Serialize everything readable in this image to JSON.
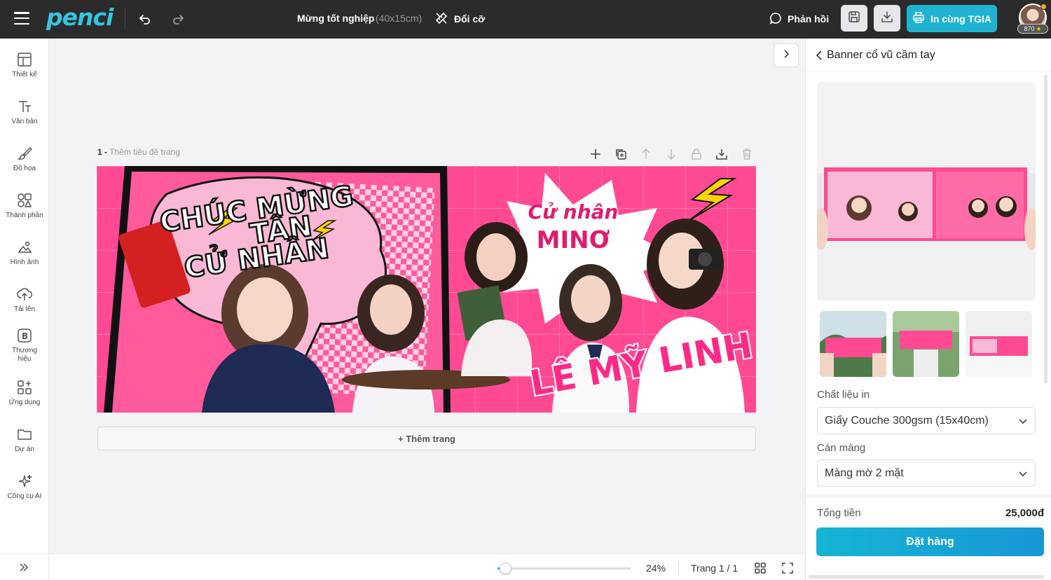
{
  "app": {
    "logo": "penci"
  },
  "topbar": {
    "doc_title": "Mừng tốt nghiệp",
    "doc_size": "(40x15cm)",
    "resize_label": "Đổi cỡ",
    "feedback_label": "Phản hồi",
    "print_label": "In cùng TGIA",
    "credits": "870"
  },
  "sidebar": {
    "items": [
      {
        "label": "Thiết kế",
        "icon": "layout-icon"
      },
      {
        "label": "Văn bản",
        "icon": "text-icon"
      },
      {
        "label": "Đồ họa",
        "icon": "brush-icon"
      },
      {
        "label": "Thành phần",
        "icon": "elements-icon"
      },
      {
        "label": "Hình ảnh",
        "icon": "image-icon"
      },
      {
        "label": "Tải lên",
        "icon": "upload-icon"
      },
      {
        "label": "Thương hiệu",
        "icon": "brand-icon"
      },
      {
        "label": "Ứng dụng",
        "icon": "apps-icon"
      },
      {
        "label": "Dự án",
        "icon": "folder-icon"
      },
      {
        "label": "Công cụ AI",
        "icon": "sparkles-icon"
      }
    ]
  },
  "canvas": {
    "page_number": "1 -",
    "page_title_placeholder": "Thêm tiêu đề trang",
    "add_page_label": "+ Thêm trang",
    "banner": {
      "headline_1": "CHÚC MỪNG",
      "headline_2": "TÂN",
      "headline_3": "CỬ NHÂN",
      "badge_1": "Cử nhân",
      "badge_2": "MINƠ",
      "name": "LÊ MỸ LINH"
    }
  },
  "bottombar": {
    "zoom": "24%",
    "zoom_level": 0.06,
    "page_count": "Trang 1 / 1"
  },
  "panel": {
    "title": "Banner cổ vũ cầm tay",
    "material_label": "Chất liệu in",
    "material_value": "Giấy Couche 300gsm (15x40cm)",
    "lamination_label": "Cán màng",
    "lamination_value": "Màng mờ 2 mặt",
    "total_label": "Tổng tiền",
    "total_value": "25,000đ",
    "order_label": "Đặt hàng"
  },
  "colors": {
    "accent": "#1fb3d2",
    "topbar": "#2b2b2b",
    "banner_pink": "#ff3f8e",
    "banner_light_pink": "#f9b8d6",
    "bolt_yellow": "#ffd400"
  }
}
